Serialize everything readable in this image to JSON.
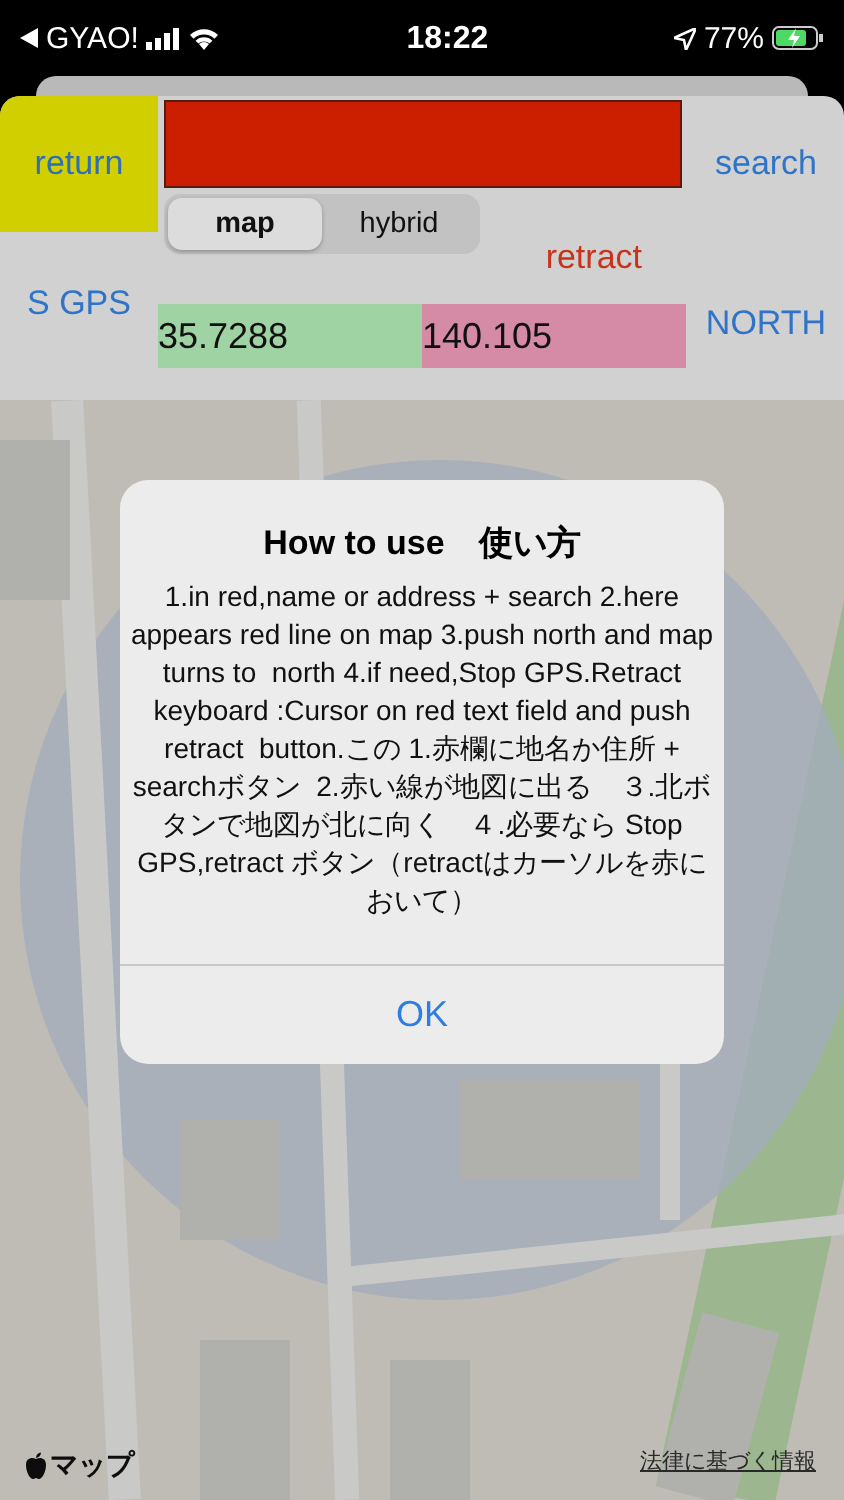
{
  "status_bar": {
    "back_app": "GYAO!",
    "time": "18:22",
    "battery": "77%"
  },
  "toolbar": {
    "return_button": "return",
    "search_button": "search",
    "map_type": [
      {
        "label": "map",
        "selected": true
      },
      {
        "label": "hybrid",
        "selected": false
      }
    ],
    "retract_button": "retract",
    "stop_gps_button": "S GPS",
    "north_button": "NORTH",
    "latitude": "35.7288",
    "longitude": "140.105"
  },
  "map": {
    "kind": "picture",
    "logo": "マップ",
    "legal_link": "法律に基づく情報"
  },
  "alert": {
    "title": "How to use　使い方",
    "message": "1.in red,name or address + search 2.here appears red line on map 3.push north and map turns to  north 4.if need,Stop GPS.Retract keyboard :Cursor on red text field and push retract  button.この 1.赤欄に地名か住所 + searchボタン  2.赤い線が地図に出る　３.北ボタンで地図が北に向く　４.必要なら Stop GPS,retract ボタン（retractはカーソルを赤において）",
    "button": "OK"
  }
}
